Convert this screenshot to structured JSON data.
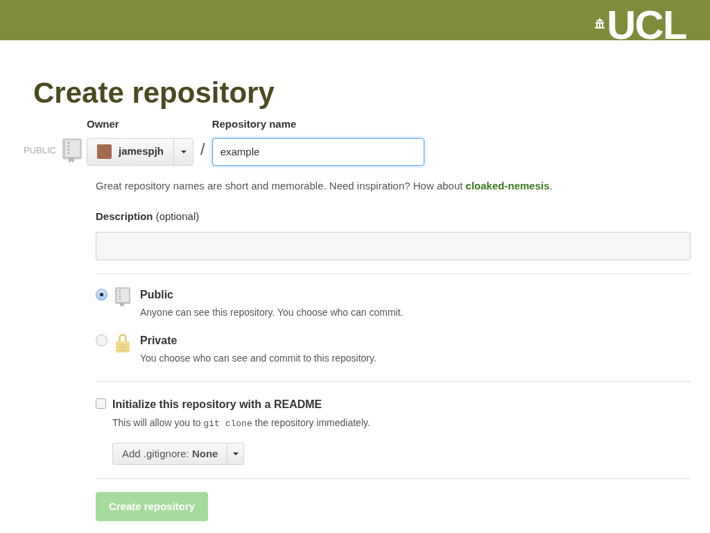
{
  "logo": {
    "text": "UCL"
  },
  "title": "Create repository",
  "owner": {
    "label": "Owner",
    "badge": "PUBLIC",
    "value": "jamespjh"
  },
  "separator": "/",
  "repo_name": {
    "label": "Repository name",
    "value": "example",
    "focused": true
  },
  "hint": {
    "text": "Great repository names are short and memorable. Need inspiration? How about ",
    "suggestion": "cloaked-nemesis",
    "end": "."
  },
  "description": {
    "label": "**Description** (optional)"
  },
  "visibility": [
    {
      "kind": "book",
      "label": "Public",
      "note": "Anyone can see this repository. You choose who can commit.",
      "selected": true
    },
    {
      "kind": "lock",
      "label": "Private",
      "note": "You choose who can see and commit to this repository.",
      "selected": false
    }
  ],
  "readme": {
    "label": "Initialize this repository with a README",
    "checked": false,
    "note_before": "This will allow you to ",
    "code": "git clone",
    "note_after": " the repository immediately."
  },
  "gitignore": {
    "label": "Add .gitignore: **None**"
  },
  "submit": {
    "label": "Create repository",
    "disabled": true
  }
}
